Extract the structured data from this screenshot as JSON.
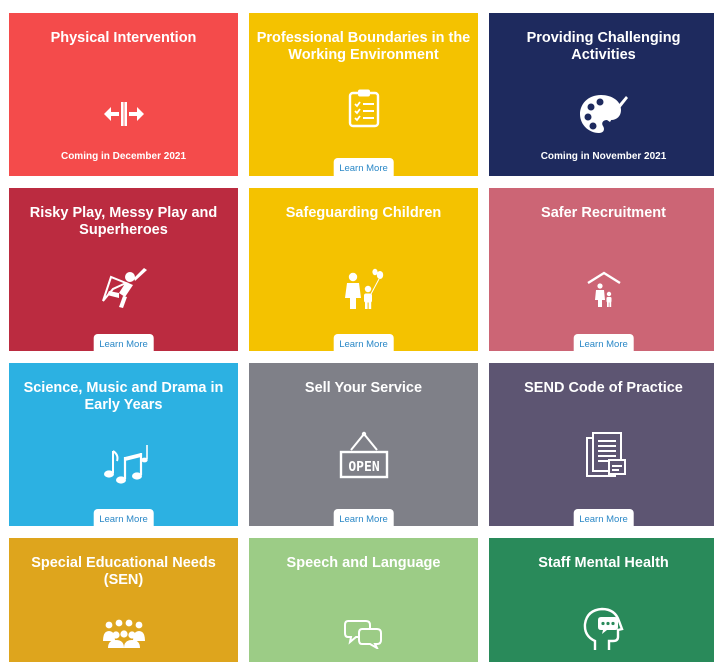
{
  "cards": [
    {
      "title": "Physical Intervention",
      "icon": "arrows-apart-icon",
      "status": "Coming in December 2021",
      "color": "#f44b4b"
    },
    {
      "title": "Professional Boundaries in the Working Environment",
      "icon": "clipboard-list-icon",
      "button": "Learn More",
      "color": "#f4c200"
    },
    {
      "title": "Providing Challenging Activities",
      "icon": "palette-icon",
      "status": "Coming in November 2021",
      "color": "#1e2a5e"
    },
    {
      "title": "Risky Play, Messy Play and Superheroes",
      "icon": "superhero-icon",
      "button": "Learn More",
      "color": "#bb2b40"
    },
    {
      "title": "Safeguarding Children",
      "icon": "family-balloon-icon",
      "button": "Learn More",
      "color": "#f4c200"
    },
    {
      "title": "Safer Recruitment",
      "icon": "shelter-family-icon",
      "button": "Learn More",
      "color": "#cc6575"
    },
    {
      "title": "Science, Music and Drama in Early Years",
      "icon": "music-notes-icon",
      "button": "Learn More",
      "color": "#2cb1e2"
    },
    {
      "title": "Sell Your Service",
      "icon": "open-sign-icon",
      "button": "Learn More",
      "color": "#7f8088"
    },
    {
      "title": "SEND Code of Practice",
      "icon": "documents-icon",
      "button": "Learn More",
      "color": "#5d5572"
    },
    {
      "title": "Special Educational Needs (SEN)",
      "icon": "group-people-icon",
      "color": "#dea51d"
    },
    {
      "title": "Speech and Language",
      "icon": "speech-bubbles-icon",
      "color": "#9ccc86"
    },
    {
      "title": "Staff Mental Health",
      "icon": "head-chat-icon",
      "color": "#298a5a"
    }
  ]
}
